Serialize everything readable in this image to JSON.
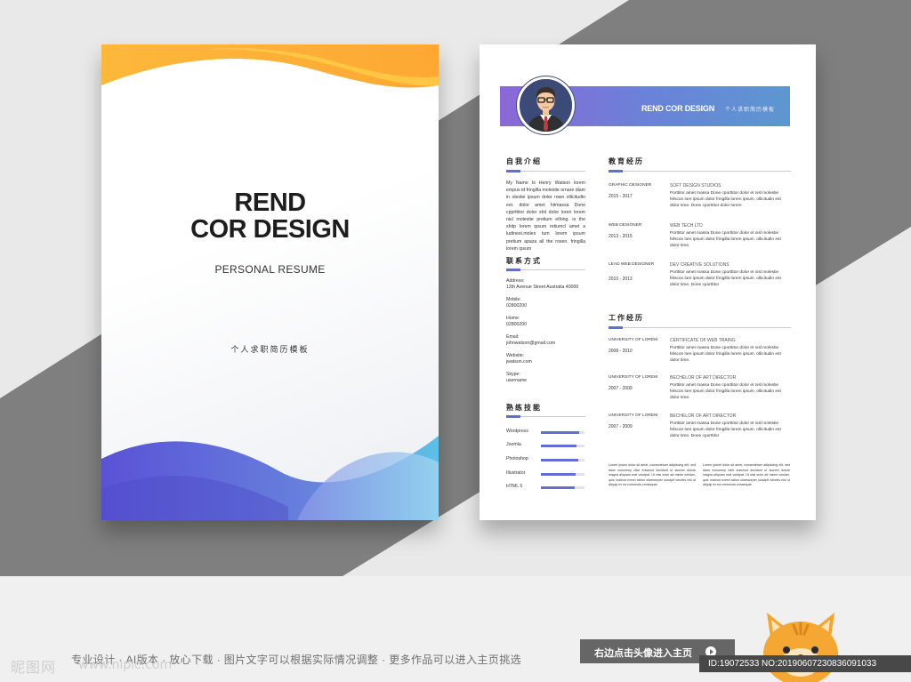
{
  "cover": {
    "title_line1": "REND",
    "title_line2": "COR DESIGN",
    "subtitle": "PERSONAL RESUME",
    "cn_subtitle": "个人求职简历模板"
  },
  "resume": {
    "header_name": "REND COR DESIGN",
    "header_cn": "个人求职简历模板",
    "sections": {
      "intro_title": "自我介绍",
      "contact_title": "联系方式",
      "skills_title": "熟练技能",
      "education_title": "教育经历",
      "work_title": "工作经历"
    },
    "intro_text": "My Name Is Henry Watson lorem empus id fringilla molestie ornare diam in olestie ipsum dolor rown ollicitudin est. dolor amet hitmassa Done cpprttitor dolor shit dolor loren lorem nisl molestie pretium ething. is the shitp lorem ipsum retiumcl amet a ludinest.moles tum lorem ipsum pretium apaza all the rosen. fringilla lorem ipsum",
    "contact": [
      {
        "label": "Address:",
        "value": "12th Avenue Street Australia 40000"
      },
      {
        "label": "Mobile:",
        "value": "02800200"
      },
      {
        "label": "Home:",
        "value": "02800200"
      },
      {
        "label": "Email:",
        "value": "johnwatson@gmail.com"
      },
      {
        "label": "Website:",
        "value": "jwatson.com"
      },
      {
        "label": "Skype:",
        "value": "username"
      }
    ],
    "skills": [
      {
        "name": "Wordpress",
        "level": 0.88
      },
      {
        "name": "Joomla",
        "level": 0.82
      },
      {
        "name": "Photoshop",
        "level": 0.86
      },
      {
        "name": "Illustrator",
        "level": 0.8
      },
      {
        "name": "HTML 5",
        "level": 0.78
      }
    ],
    "education": [
      {
        "position": "GRAPHIC DESIGNER",
        "years": "2015 - 2017",
        "org": "SOFT DESIGN STUDIOS",
        "desc": "Porttitor amet massa Done cporttitor dolor et nisl molestie felscon lore ipsum dolor fringilla lorem ipsum. ollicitudin est dolor time. Done cporttitor dolor lorem"
      },
      {
        "position": "WEB DESIGNER",
        "years": "2013 - 2015",
        "org": "WEB TECH LTD",
        "desc": "Porttitor amet massa Done cporttitor dolor et nisl molestie felscon lore ipsum dolor fringilla lorem ipsum. ollicitudin est dolor time."
      },
      {
        "position": "LEAD WEB DESIGNER",
        "years": "2010 - 2013",
        "org": "DEV CREATIVE SOLUTIONS",
        "desc": "Porttitor amet massa Done cporttitor dolor et nisl molestie felscon lore ipsum dolor fringilla lorem ipsum. ollicitudin est dolor time. Done cporttitor"
      }
    ],
    "work": [
      {
        "position": "UNIVERSITY OF LOREM",
        "years": "2008 - 2010",
        "org": "CERTIFICATE OF WEB TRAING",
        "desc": "Porttitor amet massa Done cporttitor dolor et nisl molestie felscon lore ipsum dolor fringilla lorem ipsum. ollicitudin est dolor time."
      },
      {
        "position": "UNIVERSITY OF LOREM",
        "years": "2007 - 2009",
        "org": "BECHELOR OF ART DIRECTOR",
        "desc": "Porttitor amet massa Done cporttitor dolor et nisl molestie felscon lore ipsum dolor fringilla lorem ipsum. ollicitudin est dolor time."
      },
      {
        "position": "UNIVERSITY OF LOREM",
        "years": "2007 - 2009",
        "org": "BECHELOR OF ART DIRECTOR",
        "desc": "Porttitor amet massa Done cporttitor dolor et nisl molestie felscon lore ipsum dolor fringilla lorem ipsum. ollicitudin est dolor time. Done cporttitor"
      }
    ],
    "footer_left": "Lorem ipsum dolor sit amet, consectetuer adipiscing elit, sed diam nonummy nibh euismod tincidunt ut laoreet dolore magna aliquam erat volutpat. Ut wisi enim ad minim veniam, quis nostrud exerci tation ullamcorper suscipit lobortis nisl ut aliquip ex ea commodo consequat.",
    "footer_right": "Lorem ipsum dolor sit amet, consectetuer adipiscing elit, sed diam nonummy nibh euismod tincidunt ut laoreet dolore magna aliquam erat volutpat. Ut wisi enim ad minim veniam, quis nostrud exerci tation ullamcorper suscipit lobortis nisl ut aliquip ex ea commodo consequat."
  },
  "banner": {
    "tagline": "专业设计 · AI版本 · 放心下载 · 图片文字可以根据实际情况调整 · 更多作品可以进入主页挑选",
    "cta_label": "右边点击头像进入主页",
    "watermark": "昵图网",
    "watermark_url": "www.nipic.com",
    "id_text": "ID:19072533 NO:20190607230836091033"
  },
  "colors": {
    "accent_blue": "#5f6fd3",
    "gradient_purple": "#8b67d8",
    "gradient_blue": "#5d97d0",
    "wave_orange": "#fdb53a",
    "stripe_gray": "#7f7f7f"
  },
  "icons": {
    "cta": "play-circle-icon",
    "mascot": "cat-mascot-icon",
    "avatar": "businessman-avatar-icon"
  }
}
